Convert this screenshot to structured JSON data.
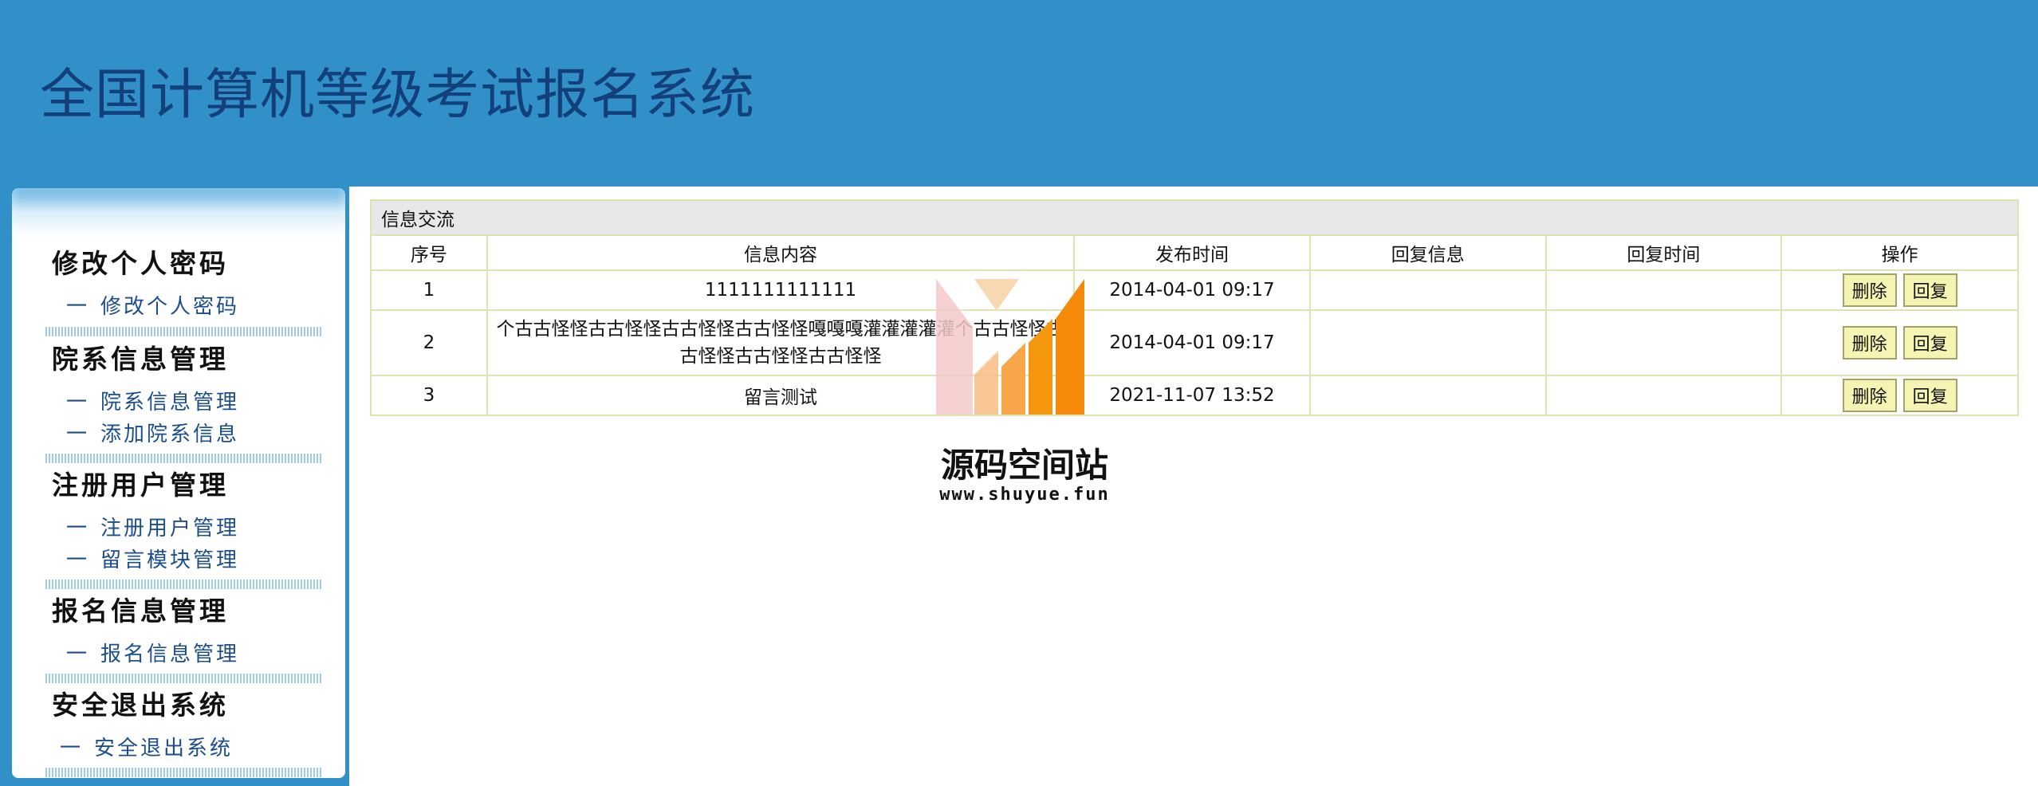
{
  "header": {
    "title": "全国计算机等级考试报名系统"
  },
  "sidebar": {
    "sections": [
      {
        "heading": "修改个人密码",
        "links": [
          "修改个人密码"
        ]
      },
      {
        "heading": "院系信息管理",
        "links": [
          "院系信息管理",
          "添加院系信息"
        ]
      },
      {
        "heading": "注册用户管理",
        "links": [
          "注册用户管理",
          "留言模块管理"
        ]
      },
      {
        "heading": "报名信息管理",
        "links": [
          "报名信息管理"
        ]
      },
      {
        "heading": "安全退出系统",
        "links": [
          "安全退出系统"
        ]
      }
    ],
    "dash": "一"
  },
  "main": {
    "caption": "信息交流",
    "columns": [
      "序号",
      "信息内容",
      "发布时间",
      "回复信息",
      "回复时间",
      "操作"
    ],
    "rows": [
      {
        "no": "1",
        "content": "1111111111111",
        "publish_time": "2014-04-01 09:17",
        "reply": "",
        "reply_time": ""
      },
      {
        "no": "2",
        "content": "个古古怪怪古古怪怪古古怪怪古古怪怪嘎嘎嘎灌灌灌灌灌个古古怪怪古古怪怪古古怪怪古古怪怪",
        "publish_time": "2014-04-01 09:17",
        "reply": "",
        "reply_time": ""
      },
      {
        "no": "3",
        "content": "留言测试",
        "publish_time": "2021-11-07 13:52",
        "reply": "",
        "reply_time": ""
      }
    ],
    "actions": {
      "delete_label": "删除",
      "reply_label": "回复"
    }
  },
  "watermark": {
    "title": "源码空间站",
    "url": "www.shuyue.fun",
    "colors": {
      "orange": "#f5890a",
      "light_orange": "#f8b96a",
      "pink": "#f3c9c9"
    }
  },
  "colors": {
    "header_bg": "#3190c8",
    "header_title": "#133f7a",
    "link": "#1b4e8c",
    "table_border": "#dfe3b4",
    "button_bg": "#f5f4b2"
  }
}
